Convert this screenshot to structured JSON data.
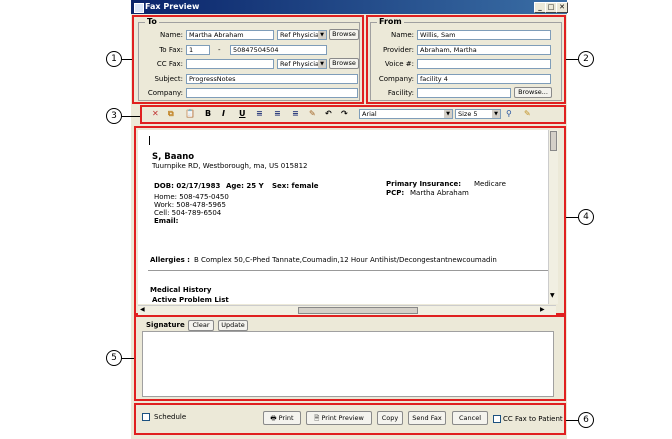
{
  "window": {
    "title": "Fax Preview"
  },
  "callouts": [
    "1",
    "2",
    "3",
    "4",
    "5",
    "6"
  ],
  "to": {
    "title": "To",
    "name_label": "Name:",
    "name_value": "Martha Abraham",
    "name_type": "Ref Physicia",
    "browse": "Browse",
    "fax_label": "To Fax:",
    "fax_prefix": "1",
    "fax_dash": "-",
    "fax_number": "50847504504",
    "ccfax_label": "CC Fax:",
    "ccfax_value": "",
    "ccfax_type": "Ref Physicia",
    "subject_label": "Subject:",
    "subject_value": "ProgressNotes",
    "company_label": "Company:",
    "company_value": ""
  },
  "from": {
    "title": "From",
    "name_label": "Name:",
    "name_value": "Willis, Sam",
    "provider_label": "Provider:",
    "provider_value": "Abraham, Martha",
    "voice_label": "Voice #:",
    "voice_value": "",
    "company_label": "Company:",
    "company_value": "facility 4",
    "facility_label": "Facility:",
    "facility_value": "",
    "browse": "Browse..."
  },
  "toolbar": {
    "font": "Arial",
    "size": "Size 5",
    "icons": [
      "delete-icon",
      "copy-icon",
      "paste-icon",
      "bold-icon",
      "italic-icon",
      "underline-icon",
      "align-left-icon",
      "align-center-icon",
      "align-right-icon",
      "spellcheck-icon",
      "undo-icon",
      "redo-icon",
      "zoom-icon",
      "edit-icon"
    ],
    "bold": "B",
    "italic": "I",
    "underline": "U"
  },
  "document": {
    "patient_name": "S, Baano",
    "address": "Tuurnpike RD, Westborough, ma, US 015812",
    "dob": "DOB: 02/17/1983",
    "age": "Age: 25 Y",
    "sex": "Sex: female",
    "home": "Home:  508-475-0450",
    "work": "Work:  508-478-5965",
    "cell": "Cell:  504-789-6504",
    "email": "Email:",
    "insurance_label": "Primary Insurance:",
    "insurance_value": "Medicare",
    "pcp_label": "PCP:",
    "pcp_value": "Martha Abraham",
    "allergies_label": "Allergies :",
    "allergies_value": "B Complex 50,C-Phed Tannate,Coumadin,12 Hour Antihist/Decongestantnewcoumadin",
    "medical_history": "Medical History",
    "active_problems": "Active Problem List"
  },
  "signature": {
    "tab": "Signature",
    "clear": "Clear",
    "update": "Update"
  },
  "footer": {
    "schedule": "Schedule",
    "print": "Print",
    "print_preview": "Print Preview",
    "copy": "Copy",
    "send_fax": "Send Fax",
    "cancel": "Cancel",
    "cc_fax": "CC Fax to Patient"
  }
}
